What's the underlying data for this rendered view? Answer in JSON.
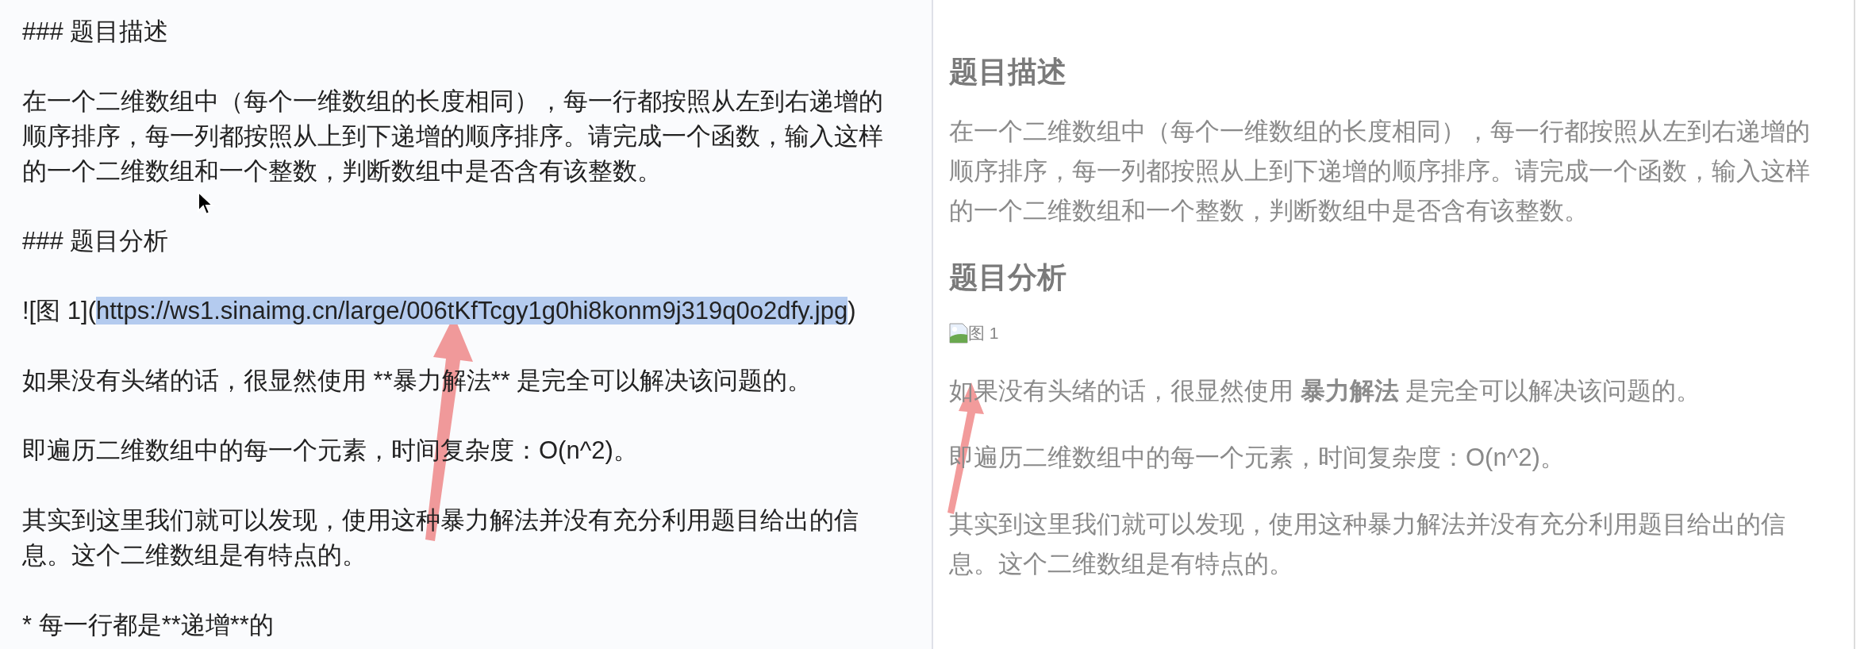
{
  "editor": {
    "blocks": [
      {
        "kind": "text",
        "lines": [
          "### 题目描述"
        ]
      },
      {
        "kind": "text",
        "lines": [
          "在一个二维数组中（每个一维数组的长度相同），每一行都按照从左到右递增的",
          "顺序排序，每一列都按照从上到下递增的顺序排序。请完成一个函数，输入这样",
          "的一个二维数组和一个整数，判断数组中是否含有该整数。"
        ]
      },
      {
        "kind": "text",
        "lines": [
          "### 题目分析"
        ]
      },
      {
        "kind": "link",
        "before": "![图 1](",
        "selected": "https://ws1.sinaimg.cn/large/006tKfTcgy1g0hi8konm9j319q0o2dfy.jpg",
        "after": ")"
      },
      {
        "kind": "text",
        "lines": [
          "如果没有头绪的话，很显然使用 **暴力解法** 是完全可以解决该问题的。"
        ]
      },
      {
        "kind": "text",
        "lines": [
          "即遍历二维数组中的每一个元素，时间复杂度：O(n^2)。"
        ]
      },
      {
        "kind": "text",
        "lines": [
          "其实到这里我们就可以发现，使用这种暴力解法并没有充分利用题目给出的信",
          "息。这个二维数组是有特点的。"
        ]
      },
      {
        "kind": "text",
        "lines": [
          "* 每一行都是**递增**的"
        ]
      }
    ]
  },
  "preview": {
    "blocks": [
      {
        "kind": "heading",
        "text": "题目描述"
      },
      {
        "kind": "paragraph",
        "lines": [
          "在一个二维数组中（每个一维数组的长度相同），每一行都按照从左到右递增的",
          "顺序排序，每一列都按照从上到下递增的顺序排序。请完成一个函数，输入这样",
          "的一个二维数组和一个整数，判断数组中是否含有该整数。"
        ]
      },
      {
        "kind": "heading",
        "text": "题目分析"
      },
      {
        "kind": "image",
        "alt": "图 1"
      },
      {
        "kind": "paragraph",
        "lines": [
          "如果没有头绪的话，很显然使用 **暴力解法** 是完全可以解决该问题的。"
        ]
      },
      {
        "kind": "paragraph",
        "lines": [
          "即遍历二维数组中的每一个元素，时间复杂度：O(n^2)。"
        ]
      },
      {
        "kind": "paragraph",
        "lines": [
          "其实到这里我们就可以发现，使用这种暴力解法并没有充分利用题目给出的信",
          "息。这个二维数组是有特点的。"
        ]
      }
    ]
  }
}
